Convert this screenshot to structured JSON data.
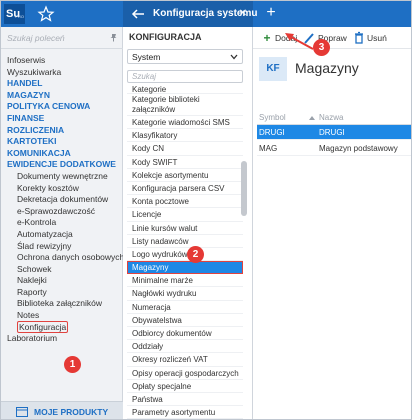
{
  "app": {
    "logo": "Su",
    "logo_sub": "PRO",
    "tab_title": "Konfiguracja systemu",
    "tab_close": "✕",
    "tab_add": "+"
  },
  "leftnav": {
    "search_placeholder": "Szukaj poleceń",
    "items": [
      {
        "label": "Infoserwis",
        "type": "normal"
      },
      {
        "label": "Wyszukiwarka",
        "type": "normal"
      },
      {
        "label": "HANDEL",
        "type": "caps"
      },
      {
        "label": "MAGAZYN",
        "type": "caps"
      },
      {
        "label": "POLITYKA CENOWA",
        "type": "caps"
      },
      {
        "label": "FINANSE",
        "type": "caps"
      },
      {
        "label": "ROZLICZENIA",
        "type": "caps"
      },
      {
        "label": "KARTOTEKI",
        "type": "caps"
      },
      {
        "label": "KOMUNIKACJA",
        "type": "caps"
      },
      {
        "label": "EWIDENCJE DODATKOWE",
        "type": "caps"
      },
      {
        "label": "Dokumenty wewnętrzne",
        "type": "sub"
      },
      {
        "label": "Korekty kosztów",
        "type": "sub"
      },
      {
        "label": "Dekretacja dokumentów",
        "type": "sub"
      },
      {
        "label": "e-Sprawozdawczość",
        "type": "sub"
      },
      {
        "label": "e-Kontrola",
        "type": "sub"
      },
      {
        "label": "Automatyzacja",
        "type": "sub"
      },
      {
        "label": "Ślad rewizyjny",
        "type": "sub"
      },
      {
        "label": "Ochrona danych osobowych",
        "type": "sub"
      },
      {
        "label": "Schowek",
        "type": "sub"
      },
      {
        "label": "Naklejki",
        "type": "sub"
      },
      {
        "label": "Raporty",
        "type": "sub"
      },
      {
        "label": "Biblioteka załączników",
        "type": "sub"
      },
      {
        "label": "Notes",
        "type": "sub"
      },
      {
        "label": "Konfiguracja",
        "type": "hl"
      },
      {
        "label": "Laboratorium",
        "type": "normal"
      }
    ],
    "bottom_label": "MOJE PRODUKTY"
  },
  "midpanel": {
    "heading": "KONFIGURACJA",
    "select_value": "System",
    "search_placeholder": "Szukaj",
    "items": [
      {
        "label": "Kategorie",
        "kind": "top"
      },
      {
        "label": "Kategorie biblioteki załączników",
        "kind": "two"
      },
      {
        "label": "Kategorie wiadomości SMS",
        "kind": "normal"
      },
      {
        "label": "Klasyfikatory",
        "kind": "normal"
      },
      {
        "label": "Kody CN",
        "kind": "normal"
      },
      {
        "label": "Kody SWIFT",
        "kind": "normal"
      },
      {
        "label": "Kolekcje asortymentu",
        "kind": "normal"
      },
      {
        "label": "Konfiguracja parsera CSV",
        "kind": "normal"
      },
      {
        "label": "Konta pocztowe",
        "kind": "normal"
      },
      {
        "label": "Licencje",
        "kind": "normal"
      },
      {
        "label": "Linie kursów walut",
        "kind": "normal"
      },
      {
        "label": "Listy nadawców",
        "kind": "normal"
      },
      {
        "label": "Logo wydruków",
        "kind": "normal"
      },
      {
        "label": "Magazyny",
        "kind": "sel"
      },
      {
        "label": "Minimalne marże",
        "kind": "normal"
      },
      {
        "label": "Nagłówki wydruku",
        "kind": "normal"
      },
      {
        "label": "Numeracja",
        "kind": "normal"
      },
      {
        "label": "Obywatelstwa",
        "kind": "normal"
      },
      {
        "label": "Odbiorcy dokumentów",
        "kind": "normal"
      },
      {
        "label": "Oddziały",
        "kind": "normal"
      },
      {
        "label": "Okresy rozliczeń VAT",
        "kind": "normal"
      },
      {
        "label": "Opisy operacji gospodarczych",
        "kind": "normal"
      },
      {
        "label": "Opłaty specjalne",
        "kind": "normal"
      },
      {
        "label": "Państwa",
        "kind": "normal"
      },
      {
        "label": "Parametry asortymentu",
        "kind": "normal"
      }
    ]
  },
  "rightpanel": {
    "toolbar": {
      "add": "Dodaj",
      "edit": "Popraw",
      "delete": "Usuń"
    },
    "badge": "KF",
    "title": "Magazyny",
    "columns": {
      "symbol": "Symbol",
      "name": "Nazwa"
    },
    "rows": [
      {
        "symbol": "DRUGI",
        "name": "DRUGI",
        "selected": true
      },
      {
        "symbol": "MAG",
        "name": "Magazyn podstawowy",
        "selected": false
      }
    ]
  },
  "annotations": {
    "step1": "1",
    "step2": "2",
    "step3": "3"
  },
  "colors": {
    "brand": "#1e6fc4",
    "accent": "#1e88e5",
    "marker": "#e53935"
  }
}
